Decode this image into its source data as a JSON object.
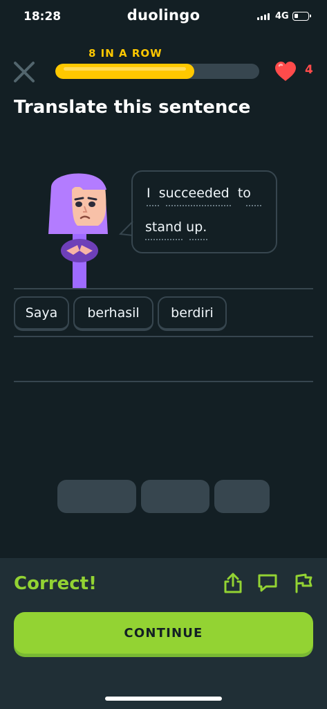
{
  "status_bar": {
    "time": "18:28",
    "brand": "duolingo",
    "network": "4G"
  },
  "header": {
    "streak_label": "8 IN A ROW",
    "progress": 0.68,
    "hearts": "4"
  },
  "exercise": {
    "title": "Translate this sentence",
    "sentence_words": [
      "I",
      "succeeded",
      "to",
      "stand",
      "up."
    ],
    "answer_tiles": [
      "Saya",
      "berhasil",
      "berdiri"
    ]
  },
  "feedback": {
    "status": "Correct!",
    "continue_label": "CONTINUE"
  },
  "colors": {
    "accent_green": "#93d333",
    "progress_yellow": "#ffc800",
    "heart_red": "#ff4b4b",
    "background": "#131f24"
  },
  "icons": [
    "close-icon",
    "heart-icon",
    "share-icon",
    "comment-icon",
    "report-flag-icon"
  ]
}
